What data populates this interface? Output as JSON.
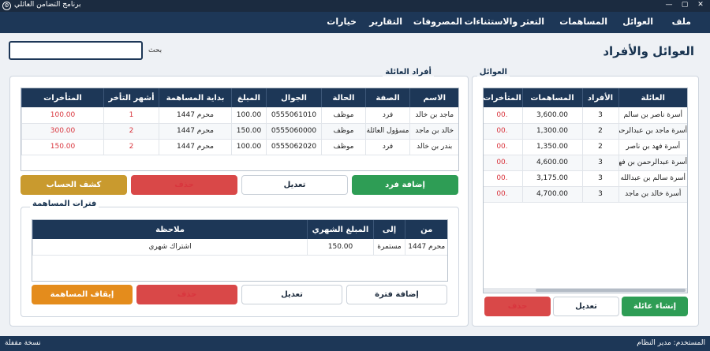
{
  "window": {
    "title": "برنامج التضامن العائلي",
    "icon": "gear-icon"
  },
  "menu": [
    "ملف",
    "العوائل",
    "المساهمات",
    "التعثر والاستثناءات",
    "المصروفات",
    "التقارير",
    "خيارات"
  ],
  "page": {
    "title": "العوائل والأفراد"
  },
  "search": {
    "label": "بحث",
    "value": ""
  },
  "families_panel": {
    "title": "العوائل",
    "columns": [
      "العائلة",
      "الأفراد",
      "المساهمات",
      "المتأخرات"
    ],
    "rows": [
      [
        "أسرة ناصر بن سالم",
        "3",
        "3,600.00",
        ".00"
      ],
      [
        "أسرة ماجد بن عبدالرحمن",
        "2",
        "1,300.00",
        ".00"
      ],
      [
        "أسرة فهد بن ناصر",
        "2",
        "1,350.00",
        ".00"
      ],
      [
        "أسرة عبدالرحمن بن فهد",
        "3",
        "4,600.00",
        ".00"
      ],
      [
        "أسرة سالم بن عبدالله",
        "3",
        "3,175.00",
        ".00"
      ],
      [
        "أسرة خالد بن ماجد",
        "3",
        "4,700.00",
        ".00"
      ]
    ],
    "buttons": {
      "create": "إنشاء عائلة",
      "edit": "تعديل",
      "delete": "حذف"
    }
  },
  "members_panel": {
    "title": "أفراد العائلة",
    "columns": [
      "الاسم",
      "الصفة",
      "الحالة",
      "الجوال",
      "المبلغ",
      "بداية المساهمة",
      "أشهر التأخر",
      "المتأخرات"
    ],
    "rows": [
      [
        "ماجد بن خالد",
        "فرد",
        "موظف",
        "0555061010",
        "100.00",
        "محرم 1447",
        "1",
        "100.00"
      ],
      [
        "خالد بن ماجد",
        "مسؤول العائلة",
        "موظف",
        "0555060000",
        "150.00",
        "محرم 1447",
        "2",
        "300.00"
      ],
      [
        "بندر بن خالد",
        "فرد",
        "موظف",
        "0555062020",
        "100.00",
        "محرم 1447",
        "2",
        "150.00"
      ]
    ],
    "buttons": {
      "add": "إضافة فرد",
      "edit": "تعديل",
      "delete": "حذف",
      "statement": "كشف الحساب"
    }
  },
  "periods_panel": {
    "title": "فترات المساهمة",
    "columns": [
      "من",
      "إلى",
      "المبلغ الشهري",
      "ملاحظة"
    ],
    "rows": [
      [
        "محرم 1447",
        "مستمرة",
        "150.00",
        "اشتراك شهري"
      ]
    ],
    "buttons": {
      "add": "إضافة فترة",
      "edit": "تعديل",
      "delete": "حذف",
      "stop": "إيقاف المساهمة"
    }
  },
  "status": {
    "user": "المستخدم: مدير النظام",
    "version": "نسخة مقفلة"
  },
  "colors": {
    "navy": "#1d3757",
    "green": "#2e9d55",
    "red": "#d94848",
    "gold": "#c99a2e",
    "orange": "#e48c1c",
    "overdue": "#d9363e"
  }
}
